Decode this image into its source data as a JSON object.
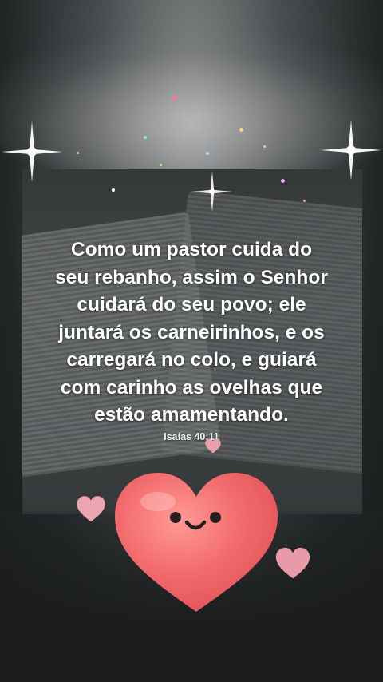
{
  "quote": {
    "lines": [
      "Como um pastor cuida do",
      "seu rebanho, assim o Senhor",
      "cuidará do seu povo; ele",
      "juntará os carneirinhos, e os",
      "carregará no colo, e guiará",
      "com carinho as ovelhas que",
      "estão amamentando."
    ]
  },
  "reference": "Isaías 40:11",
  "colors": {
    "heart": "#f06b6b",
    "small_heart": "#e8a1ab",
    "text": "#ffffff"
  },
  "icons": [
    "smiling-heart-icon",
    "small-heart-icon",
    "sparkle-icon"
  ]
}
